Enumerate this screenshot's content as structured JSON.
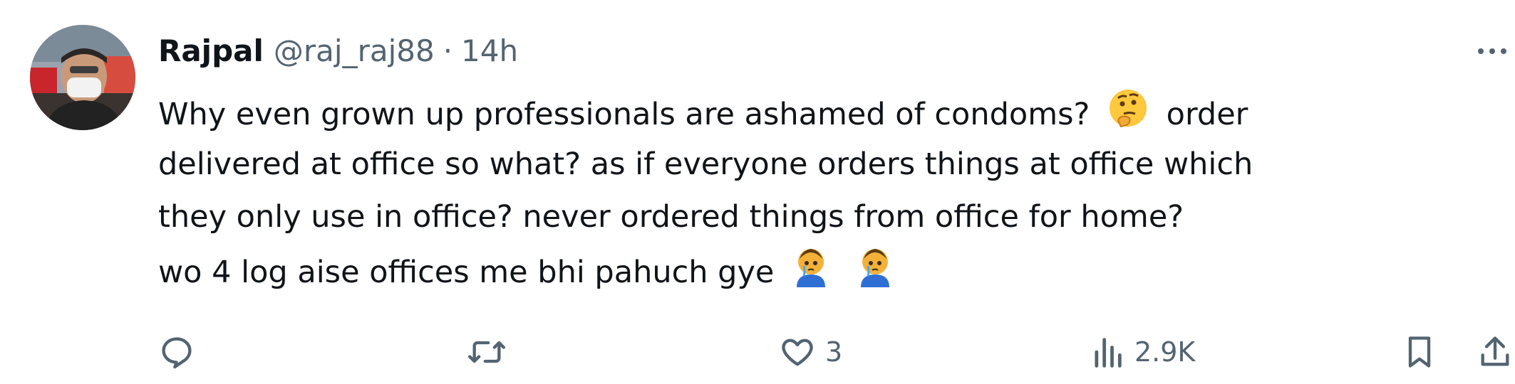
{
  "author": {
    "name": "Rajpal",
    "handle": "@raj_raj88",
    "separator": "·",
    "time": "14h"
  },
  "tweet": {
    "lines": [
      "Why even grown up professionals are ashamed of  condoms?",
      "order",
      "delivered at office so what? as if everyone orders things at office which",
      "they only use in office? never ordered things from office for home?",
      "wo 4 log aise offices me bhi pahuch gye"
    ],
    "emojis": [
      "thinking-face-emoji",
      "face-holding-back-tears-emoji"
    ]
  },
  "actions": {
    "reply_count": "",
    "retweet_count": "",
    "like_count": "3",
    "views_count": "2.9K"
  },
  "colors": {
    "text": "#0f1419",
    "secondary": "#536471",
    "background": "#ffffff"
  },
  "icons": [
    "more-icon",
    "reply-icon",
    "retweet-icon",
    "like-icon",
    "views-icon",
    "bookmark-icon",
    "share-icon"
  ]
}
